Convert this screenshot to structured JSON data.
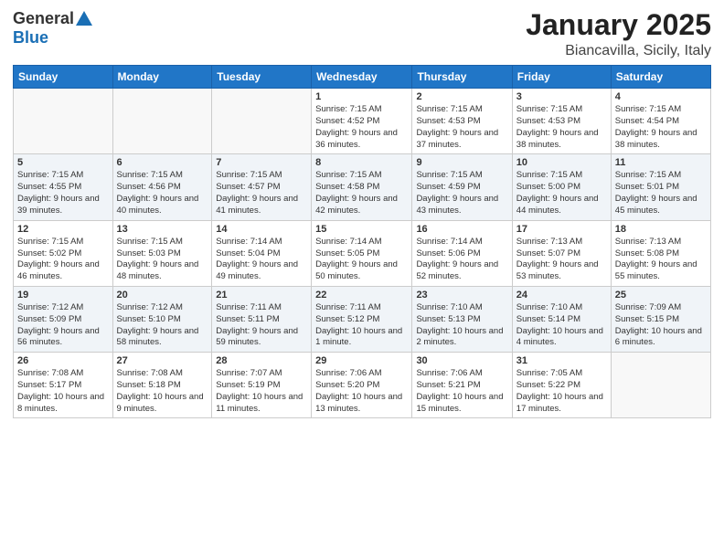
{
  "header": {
    "logo_general": "General",
    "logo_blue": "Blue",
    "month": "January 2025",
    "location": "Biancavilla, Sicily, Italy"
  },
  "weekdays": [
    "Sunday",
    "Monday",
    "Tuesday",
    "Wednesday",
    "Thursday",
    "Friday",
    "Saturday"
  ],
  "weeks": [
    [
      {
        "day": "",
        "info": ""
      },
      {
        "day": "",
        "info": ""
      },
      {
        "day": "",
        "info": ""
      },
      {
        "day": "1",
        "info": "Sunrise: 7:15 AM\nSunset: 4:52 PM\nDaylight: 9 hours and 36 minutes."
      },
      {
        "day": "2",
        "info": "Sunrise: 7:15 AM\nSunset: 4:53 PM\nDaylight: 9 hours and 37 minutes."
      },
      {
        "day": "3",
        "info": "Sunrise: 7:15 AM\nSunset: 4:53 PM\nDaylight: 9 hours and 38 minutes."
      },
      {
        "day": "4",
        "info": "Sunrise: 7:15 AM\nSunset: 4:54 PM\nDaylight: 9 hours and 38 minutes."
      }
    ],
    [
      {
        "day": "5",
        "info": "Sunrise: 7:15 AM\nSunset: 4:55 PM\nDaylight: 9 hours and 39 minutes."
      },
      {
        "day": "6",
        "info": "Sunrise: 7:15 AM\nSunset: 4:56 PM\nDaylight: 9 hours and 40 minutes."
      },
      {
        "day": "7",
        "info": "Sunrise: 7:15 AM\nSunset: 4:57 PM\nDaylight: 9 hours and 41 minutes."
      },
      {
        "day": "8",
        "info": "Sunrise: 7:15 AM\nSunset: 4:58 PM\nDaylight: 9 hours and 42 minutes."
      },
      {
        "day": "9",
        "info": "Sunrise: 7:15 AM\nSunset: 4:59 PM\nDaylight: 9 hours and 43 minutes."
      },
      {
        "day": "10",
        "info": "Sunrise: 7:15 AM\nSunset: 5:00 PM\nDaylight: 9 hours and 44 minutes."
      },
      {
        "day": "11",
        "info": "Sunrise: 7:15 AM\nSunset: 5:01 PM\nDaylight: 9 hours and 45 minutes."
      }
    ],
    [
      {
        "day": "12",
        "info": "Sunrise: 7:15 AM\nSunset: 5:02 PM\nDaylight: 9 hours and 46 minutes."
      },
      {
        "day": "13",
        "info": "Sunrise: 7:15 AM\nSunset: 5:03 PM\nDaylight: 9 hours and 48 minutes."
      },
      {
        "day": "14",
        "info": "Sunrise: 7:14 AM\nSunset: 5:04 PM\nDaylight: 9 hours and 49 minutes."
      },
      {
        "day": "15",
        "info": "Sunrise: 7:14 AM\nSunset: 5:05 PM\nDaylight: 9 hours and 50 minutes."
      },
      {
        "day": "16",
        "info": "Sunrise: 7:14 AM\nSunset: 5:06 PM\nDaylight: 9 hours and 52 minutes."
      },
      {
        "day": "17",
        "info": "Sunrise: 7:13 AM\nSunset: 5:07 PM\nDaylight: 9 hours and 53 minutes."
      },
      {
        "day": "18",
        "info": "Sunrise: 7:13 AM\nSunset: 5:08 PM\nDaylight: 9 hours and 55 minutes."
      }
    ],
    [
      {
        "day": "19",
        "info": "Sunrise: 7:12 AM\nSunset: 5:09 PM\nDaylight: 9 hours and 56 minutes."
      },
      {
        "day": "20",
        "info": "Sunrise: 7:12 AM\nSunset: 5:10 PM\nDaylight: 9 hours and 58 minutes."
      },
      {
        "day": "21",
        "info": "Sunrise: 7:11 AM\nSunset: 5:11 PM\nDaylight: 9 hours and 59 minutes."
      },
      {
        "day": "22",
        "info": "Sunrise: 7:11 AM\nSunset: 5:12 PM\nDaylight: 10 hours and 1 minute."
      },
      {
        "day": "23",
        "info": "Sunrise: 7:10 AM\nSunset: 5:13 PM\nDaylight: 10 hours and 2 minutes."
      },
      {
        "day": "24",
        "info": "Sunrise: 7:10 AM\nSunset: 5:14 PM\nDaylight: 10 hours and 4 minutes."
      },
      {
        "day": "25",
        "info": "Sunrise: 7:09 AM\nSunset: 5:15 PM\nDaylight: 10 hours and 6 minutes."
      }
    ],
    [
      {
        "day": "26",
        "info": "Sunrise: 7:08 AM\nSunset: 5:17 PM\nDaylight: 10 hours and 8 minutes."
      },
      {
        "day": "27",
        "info": "Sunrise: 7:08 AM\nSunset: 5:18 PM\nDaylight: 10 hours and 9 minutes."
      },
      {
        "day": "28",
        "info": "Sunrise: 7:07 AM\nSunset: 5:19 PM\nDaylight: 10 hours and 11 minutes."
      },
      {
        "day": "29",
        "info": "Sunrise: 7:06 AM\nSunset: 5:20 PM\nDaylight: 10 hours and 13 minutes."
      },
      {
        "day": "30",
        "info": "Sunrise: 7:06 AM\nSunset: 5:21 PM\nDaylight: 10 hours and 15 minutes."
      },
      {
        "day": "31",
        "info": "Sunrise: 7:05 AM\nSunset: 5:22 PM\nDaylight: 10 hours and 17 minutes."
      },
      {
        "day": "",
        "info": ""
      }
    ]
  ]
}
